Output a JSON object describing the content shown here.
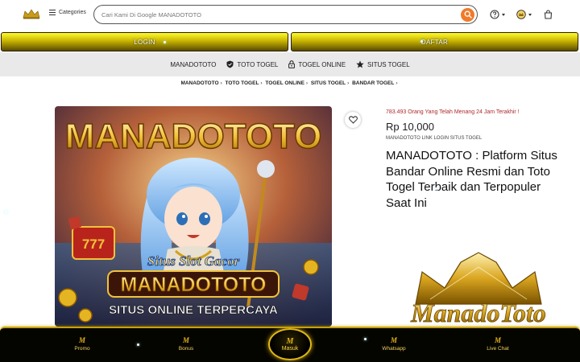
{
  "header": {
    "categories_label": "Categories",
    "search_placeholder": "Cari Kami Di Google MANADOTOTO"
  },
  "auth": {
    "login_label": "LOGIN",
    "daftar_label": "DAFTAR"
  },
  "nav": {
    "items": [
      {
        "label": "MANADOTOTO",
        "icon": "none"
      },
      {
        "label": "TOTO TOGEL",
        "icon": "shield-check-icon"
      },
      {
        "label": "TOGEL ONLINE",
        "icon": "lock-icon"
      },
      {
        "label": "SITUS TOGEL",
        "icon": "star-icon"
      }
    ]
  },
  "breadcrumb": [
    "MANADOTOTO",
    "TOTO TOGEL",
    "TOGEL ONLINE",
    "SITUS TOGEL",
    "BANDAR TOGEL"
  ],
  "hero": {
    "brand": "MANADOTOTO",
    "tagline": "Situs Slot Gacor",
    "banner": "MANADOTOTO",
    "footer_text": "SITUS ONLINE TERPERCAYA"
  },
  "product": {
    "winners_text": "783.493 Orang Yang Telah Menang 24 Jam Terakhir !",
    "price": "Rp 10,000",
    "subtitle": "MANADOTOTO LINK LOGIN SITUS TOGEL",
    "title": "MANADOTOTO : Platform Situs Bandar Online Resmi dan Toto Togel Terbaik dan Terpopuler Saat Ini",
    "logo_text": "ManadoToto"
  },
  "bottom_nav": {
    "promo": "Promo",
    "bonus": "Bonus",
    "masuk": "Masuk",
    "whatsapp": "Whatsapp",
    "livechat": "Live Chat"
  },
  "colors": {
    "accent_orange": "#f07a2a",
    "gold": "#e3b21a",
    "winner_red": "#b0282a"
  }
}
